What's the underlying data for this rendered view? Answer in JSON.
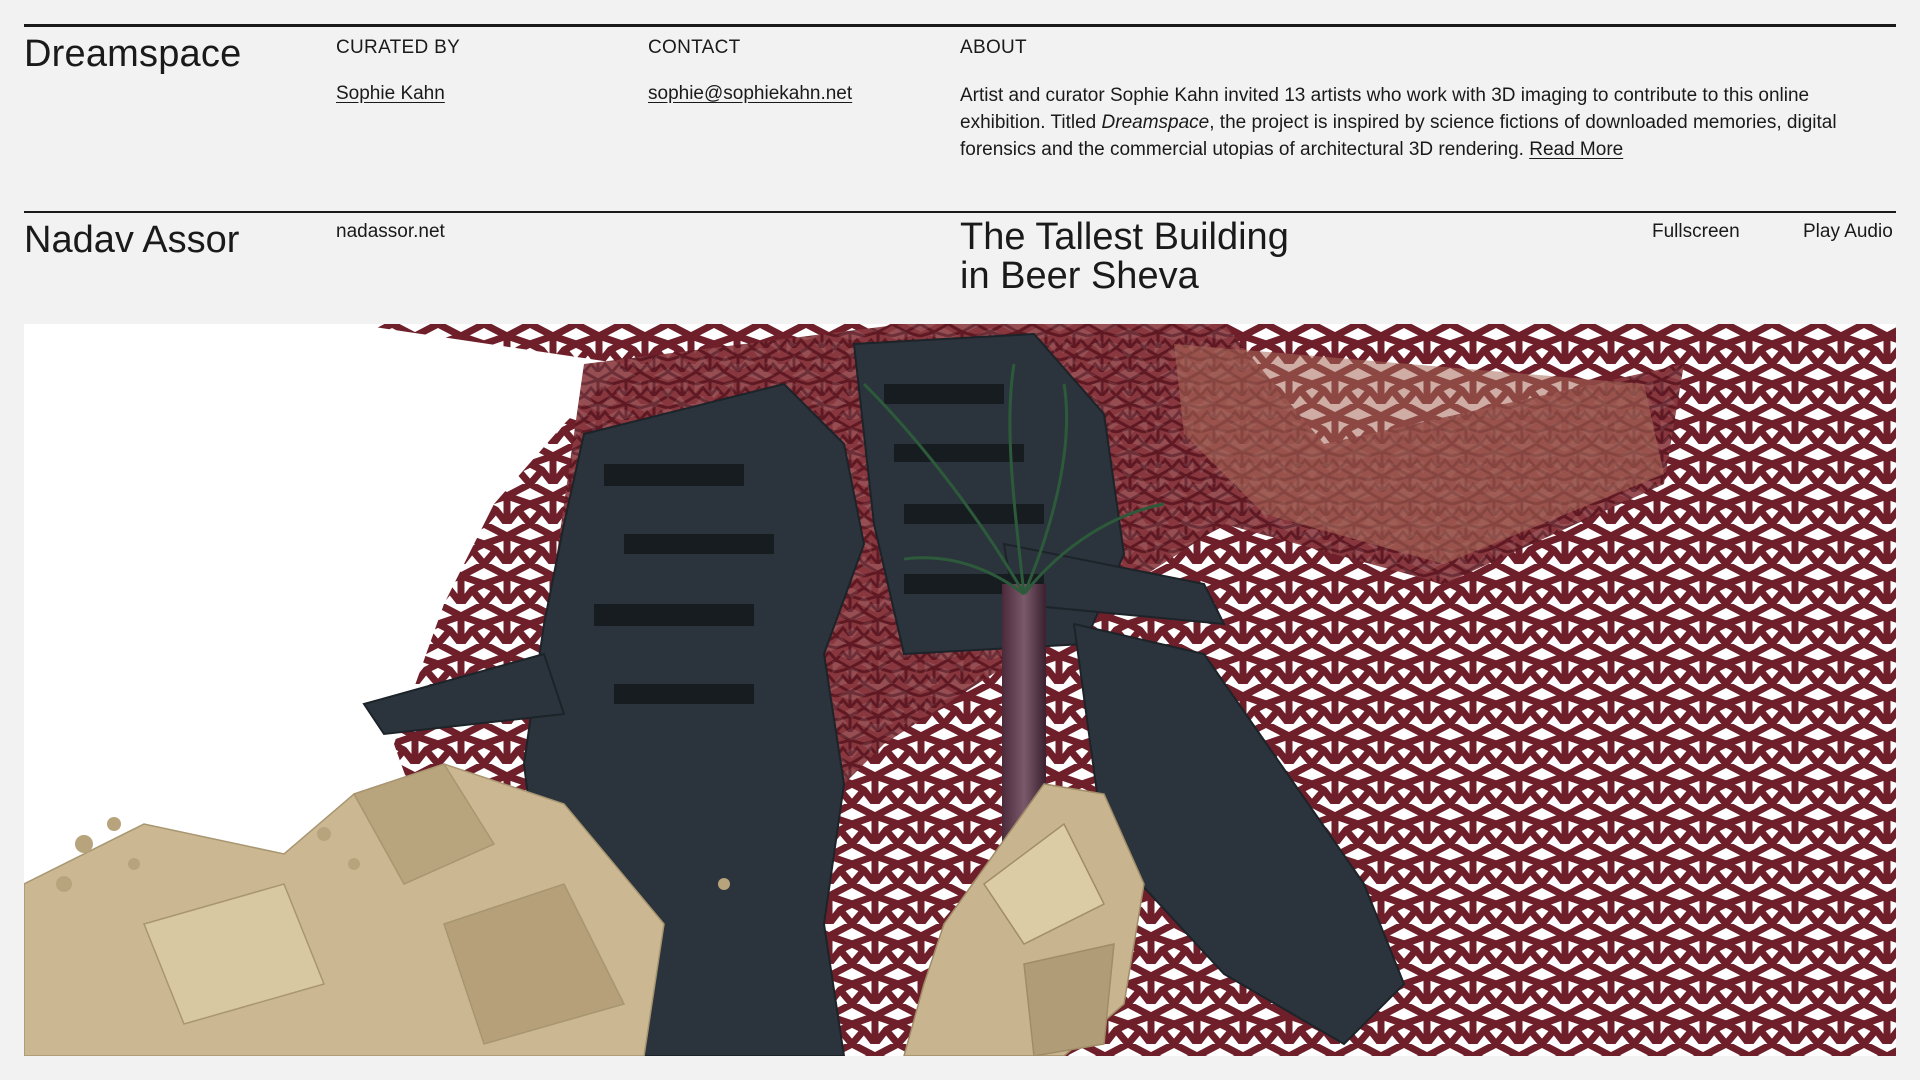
{
  "header": {
    "site_title": "Dreamspace",
    "curated_label": "CURATED BY",
    "curator_name": "Sophie Kahn",
    "contact_label": "CONTACT",
    "contact_email": "sophie@sophiekahn.net",
    "about_label": "ABOUT",
    "about_text_before": "Artist and curator Sophie Kahn invited 13 artists who work with 3D imaging to contribute to this online exhibition. Titled ",
    "about_text_italic": "Dreamspace",
    "about_text_after": ", the project is inspired by science fictions of downloaded memories, digital forensics and the commercial utopias of architectural 3D rendering. ",
    "read_more_label": "Read More"
  },
  "work": {
    "artist_name": "Nadav Assor",
    "artist_site": "nadassor.net",
    "title_line1": "The Tallest Building",
    "title_line2": "in Beer Sheva",
    "fullscreen_label": "Fullscreen",
    "play_audio_label": "Play Audio"
  },
  "colors": {
    "background": "#f2f2f2",
    "text": "#1a1a1a",
    "mesh_red": "#6e1f2a",
    "tower_slate": "#2b343c",
    "rock_sand": "#cbb892"
  }
}
